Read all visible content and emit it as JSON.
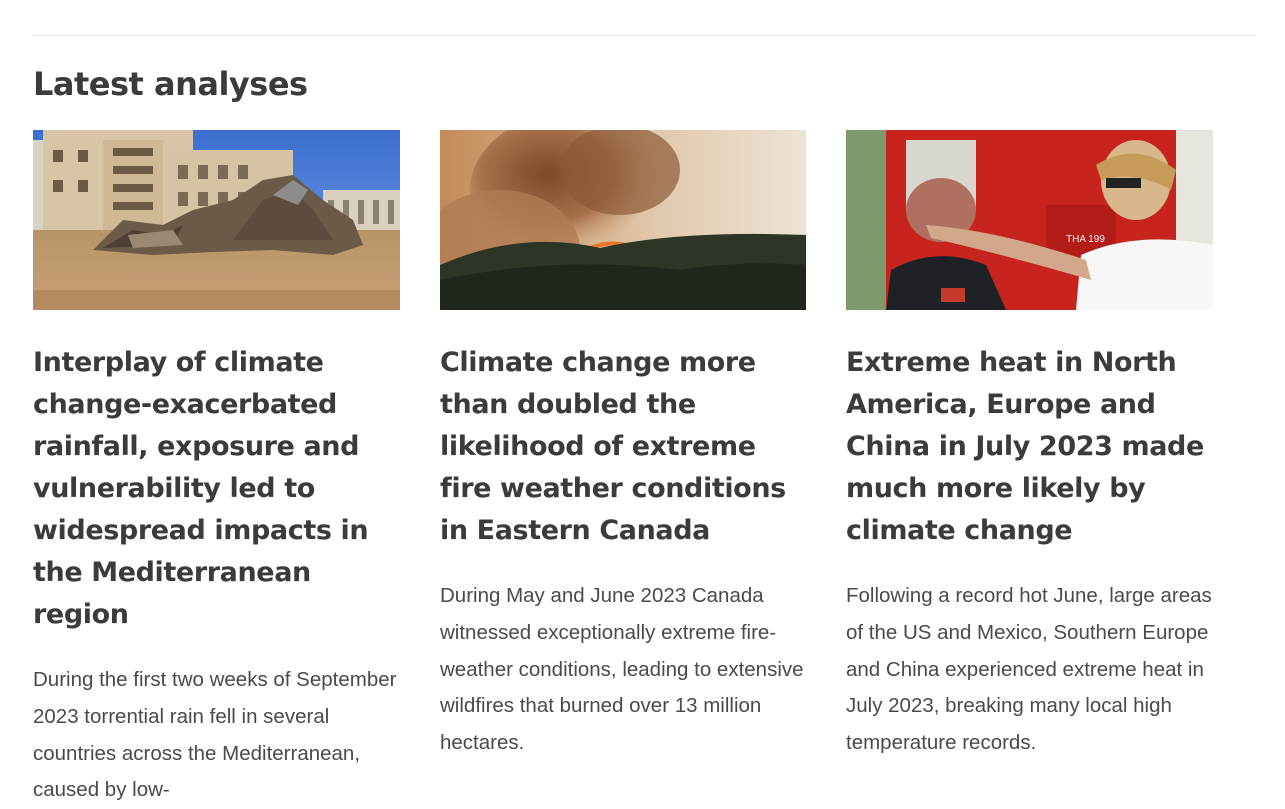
{
  "section": {
    "title": "Latest analyses"
  },
  "cards": [
    {
      "title": "Interplay of climate change-exacerbated rainfall, exposure and vulnerability led to widespread impacts in the Mediterranean region",
      "excerpt": "During the first two weeks of September 2023 torrential rain fell in several countries across the Mediterranean, caused by low-",
      "image": "flood-debris-buildings-photo"
    },
    {
      "title": "Climate change more than doubled the likelihood of extreme fire weather conditions in Eastern Canada",
      "excerpt": "During May and June 2023 Canada witnessed exceptionally extreme fire-weather conditions, leading to extensive wildfires that burned over 13 million hectares.",
      "image": "forest-wildfire-smoke-photo"
    },
    {
      "title": "Extreme heat in North America, Europe and China in July 2023 made much more likely by climate change",
      "excerpt": "Following a record hot June, large areas of the US and Mexico, Southern Europe and China experienced extreme heat in July 2023, breaking many local high temperature records.",
      "image": "firefighter-heat-relief-photo",
      "image_text": "THA 199"
    }
  ]
}
